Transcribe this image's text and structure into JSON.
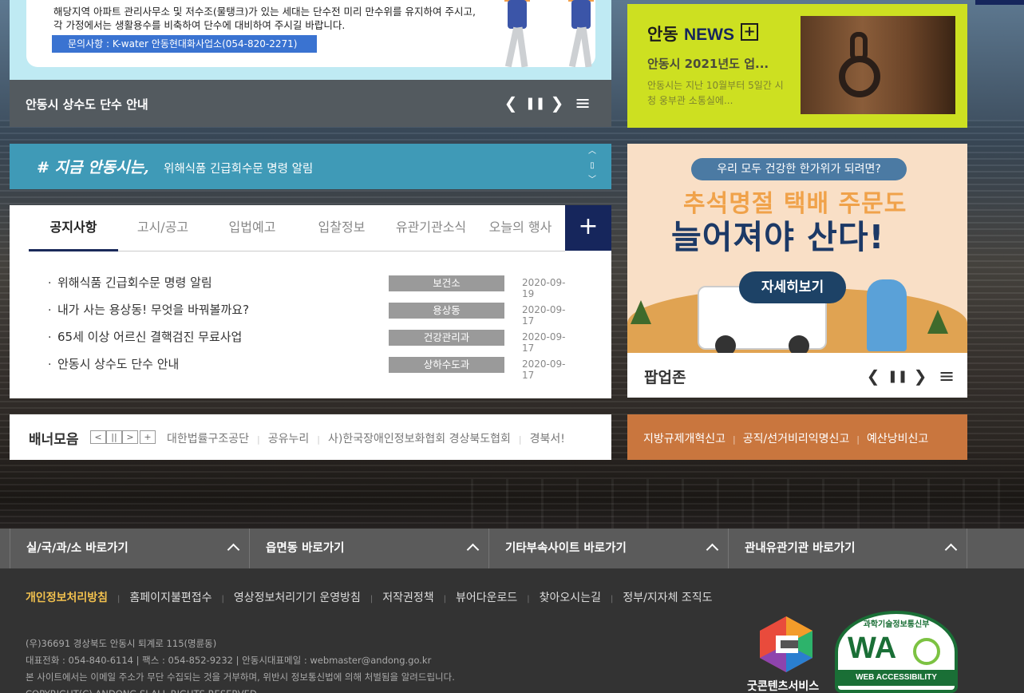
{
  "top_slide": {
    "line1": "해당지역 아파트 관리사무소 및 저수조(물탱크)가 있는 세대는 단수전 미리 만수위를 유지하여 주시고,",
    "line2": "각 가정에서는 생활용수를 비축하여 단수에 대비하여 주시길 바랍니다.",
    "contact": "문의사항 : K-water 안동현대화사업소(054-820-2271)",
    "title": "안동시 상수도 단수 안내",
    "controls": {
      "prev": "❮",
      "pause": "❚❚",
      "next": "❯",
      "list": "≡"
    }
  },
  "now_ticker": {
    "tag": "# 지금 안동시는,",
    "message": "위해식품 긴급회수문 명령 알림",
    "up": "︿",
    "stop": "▯",
    "down": "﹀"
  },
  "board": {
    "tabs": [
      "공지사항",
      "고시/공고",
      "입법예고",
      "입찰정보",
      "유관기관소식",
      "오늘의 행사"
    ],
    "more": "+",
    "rows": [
      {
        "title": "위해식품 긴급회수문 명령 알림",
        "dept": "보건소",
        "date": "2020-09-19"
      },
      {
        "title": "내가 사는 용상동! 무엇을 바꿔볼까요?",
        "dept": "용상동",
        "date": "2020-09-17"
      },
      {
        "title": "65세 이상 어르신 결핵검진 무료사업",
        "dept": "건강관리과",
        "date": "2020-09-17"
      },
      {
        "title": "안동시 상수도 단수 안내",
        "dept": "상하수도과",
        "date": "2020-09-17"
      }
    ],
    "bullet": "·"
  },
  "banner": {
    "title": "배너모음",
    "controls": {
      "prev": "<",
      "pause": "||",
      "next": ">",
      "plus": "+"
    },
    "links": [
      "대한법률구조공단",
      "공유누리",
      "사)한국장애인정보화협회 경상북도협회",
      "경북서!"
    ],
    "sep": "|"
  },
  "news": {
    "title_a": "안동",
    "title_b": "NEWS",
    "plus": "+",
    "headline": "안동시 2021년도 업...",
    "summary": "안동시는 지난 10월부터 5일간 시청 웅부관 소통실에..."
  },
  "popup": {
    "pill": "우리 모두 건강한 한가위가 되려면?",
    "line1": "추석명절 택배 주문도",
    "line2": "늘어져야 산다!",
    "button": "자세히보기",
    "zone_title": "팝업존",
    "controls": {
      "prev": "❮",
      "pause": "❚❚",
      "next": "❯",
      "list": "≡"
    }
  },
  "report": {
    "links": [
      "지방규제개혁신고",
      "공직/선거비리익명신고",
      "예산낭비신고"
    ],
    "sep": "|"
  },
  "quick_links": [
    "실/국/과/소 바로가기",
    "읍면동 바로가기",
    "기타부속사이트 바로가기",
    "관내유관기관 바로가기"
  ],
  "footer": {
    "links": [
      "개인정보처리방침",
      "홈페이지불편접수",
      "영상정보처리기기 운영방침",
      "저작권정책",
      "뷰어다운로드",
      "찾아오시는길",
      "정부/지자체 조직도"
    ],
    "sep": "|",
    "address": "(우)36691 경상북도 안동시 퇴계로 115(명륜동)",
    "contact": "대표전화 : 054-840-6114  |  팩스 : 054-852-9232  |  안동시대표메일 : webmaster@andong.go.kr",
    "notice": "본 사이트에서는 이메일 주소가 무단 수집되는 것을 거부하며, 위반시 정보통신법에 의해 처벌됨을 알려드립니다.",
    "copyright": "COPYRIGHT(C) ANDONG SI ALL RIGHTS RESERVED.",
    "gc_label": "굿콘텐츠서비스",
    "wa_top": "과학기술정보통신부",
    "wa_big": "WA",
    "wa_band": "WEB ACCESSIBILITY"
  },
  "colors": {
    "navy": "#16265c",
    "news_lime": "#cde021",
    "ticker_blue": "#3f9ab7",
    "report_orange": "#c9763e",
    "footer_link_yellow": "#f2c14e"
  }
}
